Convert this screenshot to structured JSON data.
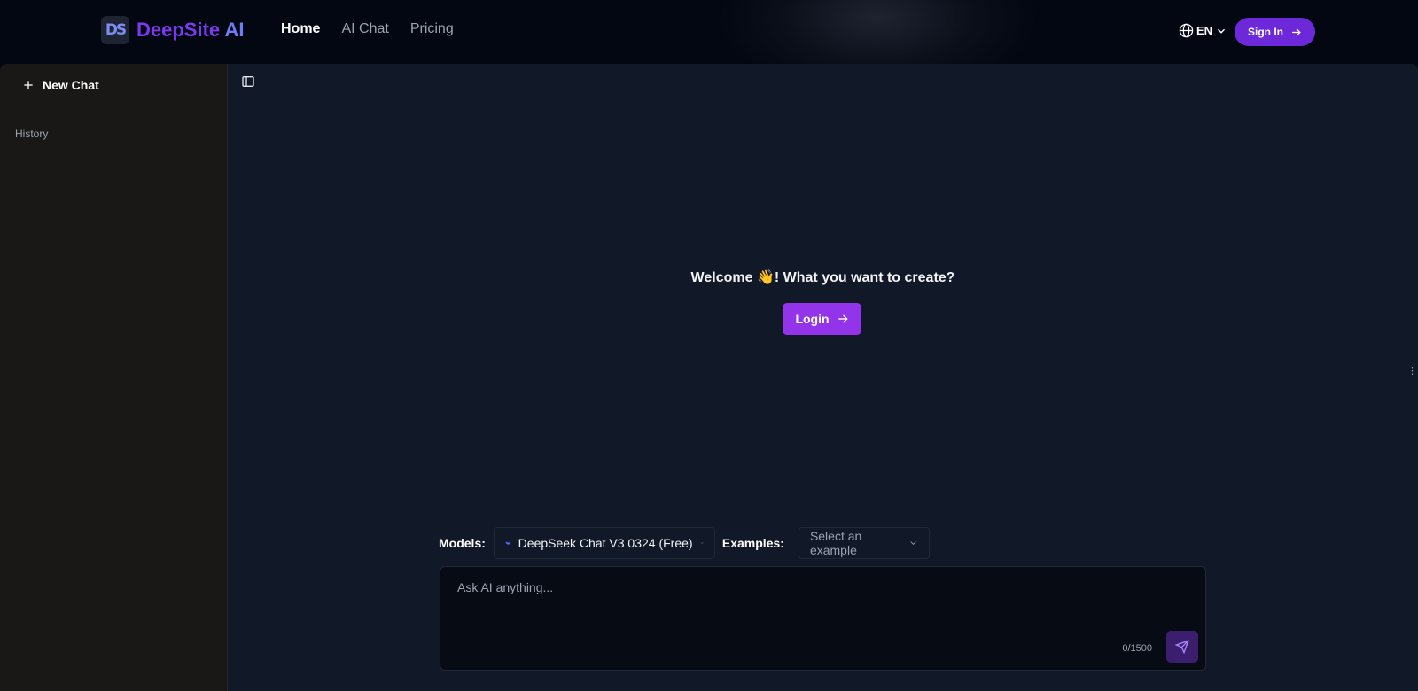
{
  "brand": {
    "mark": "DS",
    "name_part1": "DeepSite",
    "name_part2": " AI"
  },
  "nav": {
    "items": [
      {
        "label": "Home",
        "active": true
      },
      {
        "label": "AI Chat",
        "active": false
      },
      {
        "label": "Pricing",
        "active": false
      }
    ]
  },
  "header": {
    "language": "EN",
    "sign_in_label": "Sign In"
  },
  "sidebar": {
    "new_chat_label": "New Chat",
    "history_label": "History"
  },
  "main": {
    "welcome_text": "Welcome 👋! What you want to create?",
    "login_label": "Login"
  },
  "composer": {
    "models_label": "Models:",
    "selected_model": "DeepSeek Chat V3 0324 (Free)",
    "examples_label": "Examples:",
    "examples_placeholder": "Select an example",
    "input_placeholder": "Ask AI anything...",
    "char_count": "0/1500"
  },
  "colors": {
    "accent": "#9333ea",
    "accent_dark": "#6d28d9",
    "brand_blue": "#6d7cf4"
  },
  "icons": [
    "globe-icon",
    "chevron-down-icon",
    "arrow-right-icon",
    "plus-icon",
    "sidebar-toggle-icon",
    "whale-icon",
    "send-icon"
  ]
}
